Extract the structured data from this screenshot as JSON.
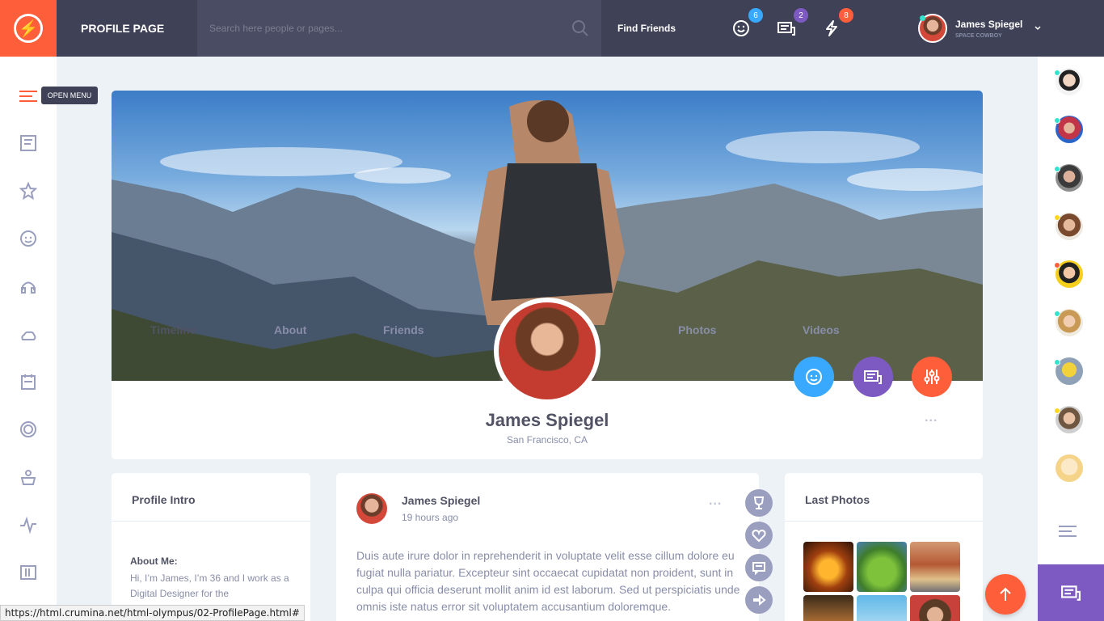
{
  "header": {
    "page_title": "PROFILE PAGE",
    "search_placeholder": "Search here people or pages...",
    "find_friends": "Find Friends",
    "badges": {
      "friend_requests": "6",
      "messages": "2",
      "notifications": "8"
    },
    "badge_colors": {
      "friend_requests": "#38a9ff",
      "messages": "#7c5ac2",
      "notifications": "#ff5e3a"
    },
    "user": {
      "name": "James Spiegel",
      "status": "SPACE COWBOY"
    }
  },
  "left_sidebar": {
    "tooltip": "OPEN MENU",
    "icons": [
      "menu-icon",
      "newsfeed-icon",
      "star-icon",
      "friend-groups-icon",
      "music-icon",
      "weather-icon",
      "calendar-icon",
      "badges-icon",
      "third-party-icon",
      "stats-icon",
      "manage-widgets-icon"
    ]
  },
  "profile": {
    "name": "James Spiegel",
    "location": "San Francisco, CA",
    "nav": {
      "timeline": "Timeline",
      "about": "About",
      "friends": "Friends",
      "photos": "Photos",
      "videos": "Videos",
      "more": "..."
    }
  },
  "profile_intro": {
    "title": "Profile Intro",
    "about_label": "About Me:",
    "about_text": "Hi, I’m James, I’m 36 and I work as a Digital Designer for the"
  },
  "post": {
    "author": "James Spiegel",
    "time": "19 hours ago",
    "more": "...",
    "text": "Duis aute irure dolor in reprehenderit in voluptate velit esse cillum dolore eu fugiat nulla pariatur. Excepteur sint occaecat cupidatat non proident, sunt in culpa qui officia deserunt mollit anim id est laborum. Sed ut perspiciatis unde omnis iste natus error sit voluptatem accusantium doloremque."
  },
  "last_photos": {
    "title": "Last Photos"
  },
  "statusbar": {
    "url": "https://html.crumina.net/html-olympus/02-ProfilePage.html#"
  },
  "colors": {
    "primary": "#ff5e3a",
    "dark": "#3f4257",
    "blue": "#38a9ff",
    "purple": "#7c5ac2"
  }
}
